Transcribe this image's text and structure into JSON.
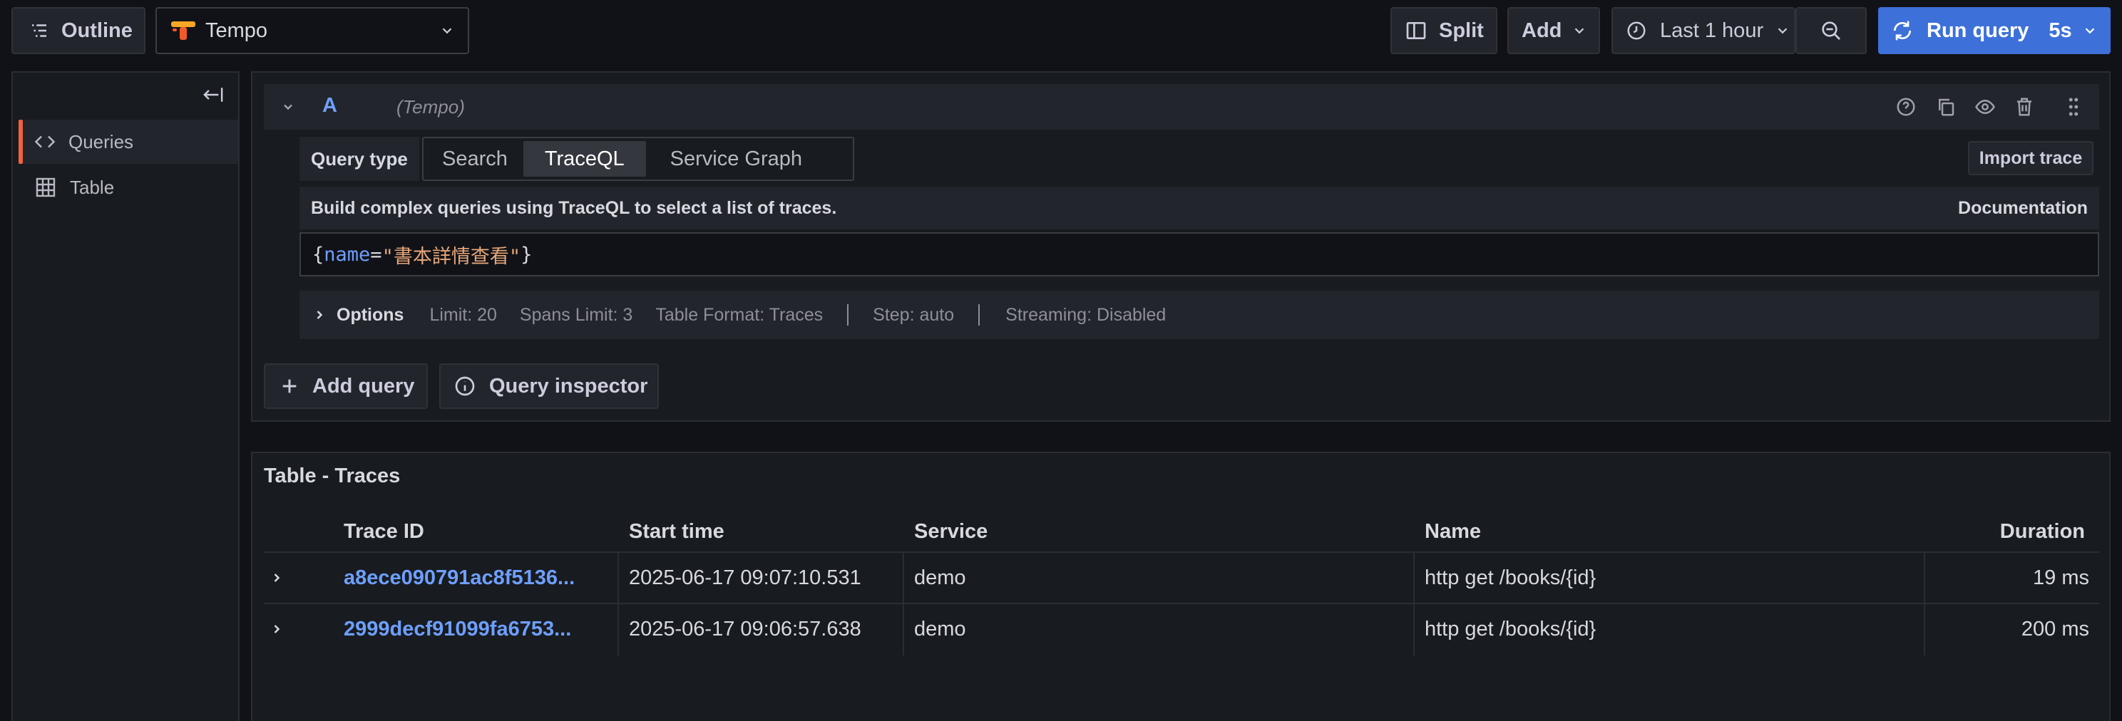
{
  "toolbar": {
    "outline_label": "Outline",
    "datasource": "Tempo",
    "split_label": "Split",
    "add_label": "Add",
    "time_range": "Last 1 hour",
    "run_query_label": "Run query",
    "refresh_interval": "5s"
  },
  "sidebar": {
    "items": [
      {
        "label": "Queries",
        "icon": "code-icon",
        "active": true
      },
      {
        "label": "Table",
        "icon": "table-icon",
        "active": false
      }
    ]
  },
  "query": {
    "ref_id": "A",
    "datasource_hint": "(Tempo)",
    "query_type_label": "Query type",
    "query_types": [
      "Search",
      "TraceQL",
      "Service Graph"
    ],
    "selected_query_type": "TraceQL",
    "import_trace_label": "Import trace",
    "help_text": "Build complex queries using TraceQL to select a list of traces.",
    "documentation_label": "Documentation",
    "editor": {
      "open_brace": "{",
      "key": "name",
      "operator": "=",
      "value": "\"書本詳情查看\"",
      "close_brace": "}"
    },
    "options": {
      "label": "Options",
      "limit": "Limit: 20",
      "spans_limit": "Spans Limit: 3",
      "table_format": "Table Format: Traces",
      "step": "Step: auto",
      "streaming": "Streaming: Disabled"
    }
  },
  "actions": {
    "add_query_label": "Add query",
    "query_inspector_label": "Query inspector"
  },
  "results": {
    "title": "Table - Traces",
    "columns": [
      "Trace ID",
      "Start time",
      "Service",
      "Name",
      "Duration"
    ],
    "rows": [
      {
        "trace_id": "a8ece090791ac8f5136...",
        "start_time": "2025-06-17 09:07:10.531",
        "service": "demo",
        "name": "http get /books/{id}",
        "duration": "19 ms"
      },
      {
        "trace_id": "2999decf91099fa6753...",
        "start_time": "2025-06-17 09:06:57.638",
        "service": "demo",
        "name": "http get /books/{id}",
        "duration": "200 ms"
      }
    ]
  },
  "colors": {
    "accent": "#3d71d9",
    "link": "#6e9fff",
    "active_marker": "#f55f3e"
  }
}
